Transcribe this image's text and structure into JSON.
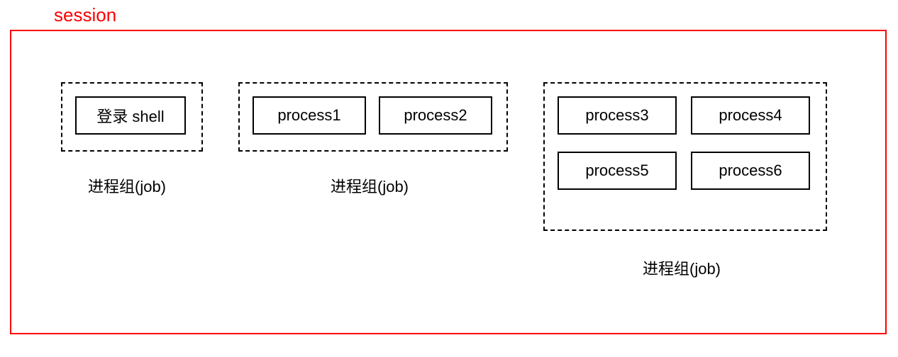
{
  "session": {
    "title": "session"
  },
  "groups": [
    {
      "label": "进程组(job)",
      "processes": [
        "登录 shell"
      ]
    },
    {
      "label": "进程组(job)",
      "processes": [
        "process1",
        "process2"
      ]
    },
    {
      "label": "进程组(job)",
      "processes": [
        "process3",
        "process4",
        "process5",
        "process6"
      ]
    }
  ]
}
